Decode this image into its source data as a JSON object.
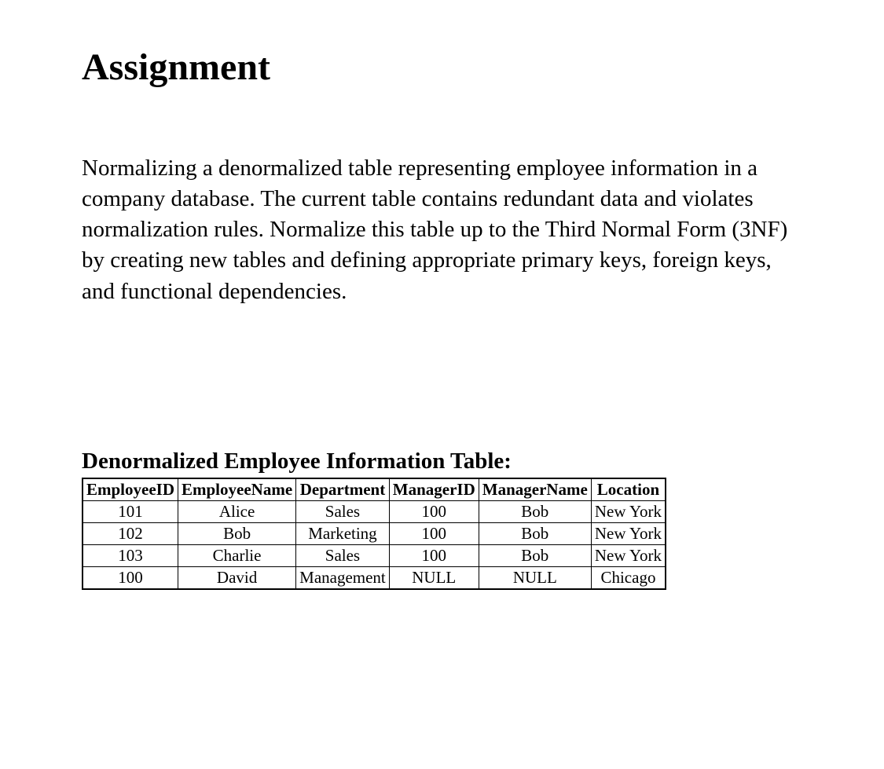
{
  "title": "Assignment",
  "description": "Normalizing a denormalized table representing employee information in a company database. The current table contains redundant data and violates normalization rules. Normalize this table up to the Third Normal Form (3NF) by creating new tables and defining appropriate primary keys, foreign keys, and functional dependencies.",
  "subtitle": "Denormalized Employee Information Table:",
  "table": {
    "headers": [
      "EmployeeID",
      "EmployeeName",
      "Department",
      "ManagerID",
      "ManagerName",
      "Location"
    ],
    "rows": [
      [
        "101",
        "Alice",
        "Sales",
        "100",
        "Bob",
        "New York"
      ],
      [
        "102",
        "Bob",
        "Marketing",
        "100",
        "Bob",
        "New York"
      ],
      [
        "103",
        "Charlie",
        "Sales",
        "100",
        "Bob",
        "New York"
      ],
      [
        "100",
        "David",
        "Management",
        "NULL",
        "NULL",
        "Chicago"
      ]
    ]
  }
}
